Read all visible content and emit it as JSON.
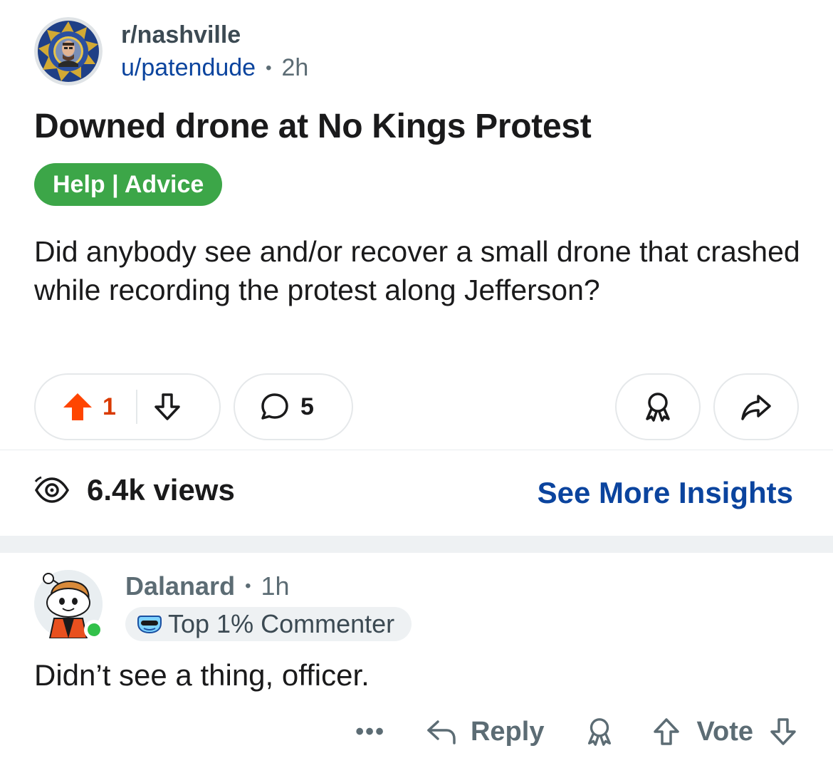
{
  "post": {
    "subreddit": "r/nashville",
    "author": "u/patendude",
    "separator": "•",
    "time": "2h",
    "title": "Downed drone at No Kings Protest",
    "flair": "Help | Advice",
    "body": "Did anybody see and/or recover a small drone that crashed while recording the protest along Jefferson?",
    "score": "1",
    "comments": "5",
    "views": "6.4k views",
    "insights_link": "See More Insights",
    "icons": {
      "subreddit_avatar": "police-badge-avatar",
      "upvote": "upvote-filled-icon",
      "downvote": "downvote-icon",
      "comment": "comment-bubble-icon",
      "award": "award-icon",
      "share": "share-icon",
      "views": "views-eye-icon"
    },
    "colors": {
      "upvote_active": "#ff4500",
      "score": "#d93a00",
      "flair_bg": "#3ca648",
      "link": "#0b449e"
    }
  },
  "comment": {
    "author": "Dalanard",
    "separator": "•",
    "time": "1h",
    "badge": "Top 1% Commenter",
    "body": "Didn’t see a thing, officer.",
    "more": "•••",
    "reply_label": "Reply",
    "vote_label": "Vote",
    "online": true,
    "icons": {
      "avatar": "snoo-avatar",
      "badge": "top-commenter-icon",
      "reply": "reply-arrow-icon",
      "award": "award-icon",
      "upvote": "upvote-icon",
      "downvote": "downvote-icon"
    },
    "colors": {
      "online": "#32c14a"
    }
  }
}
